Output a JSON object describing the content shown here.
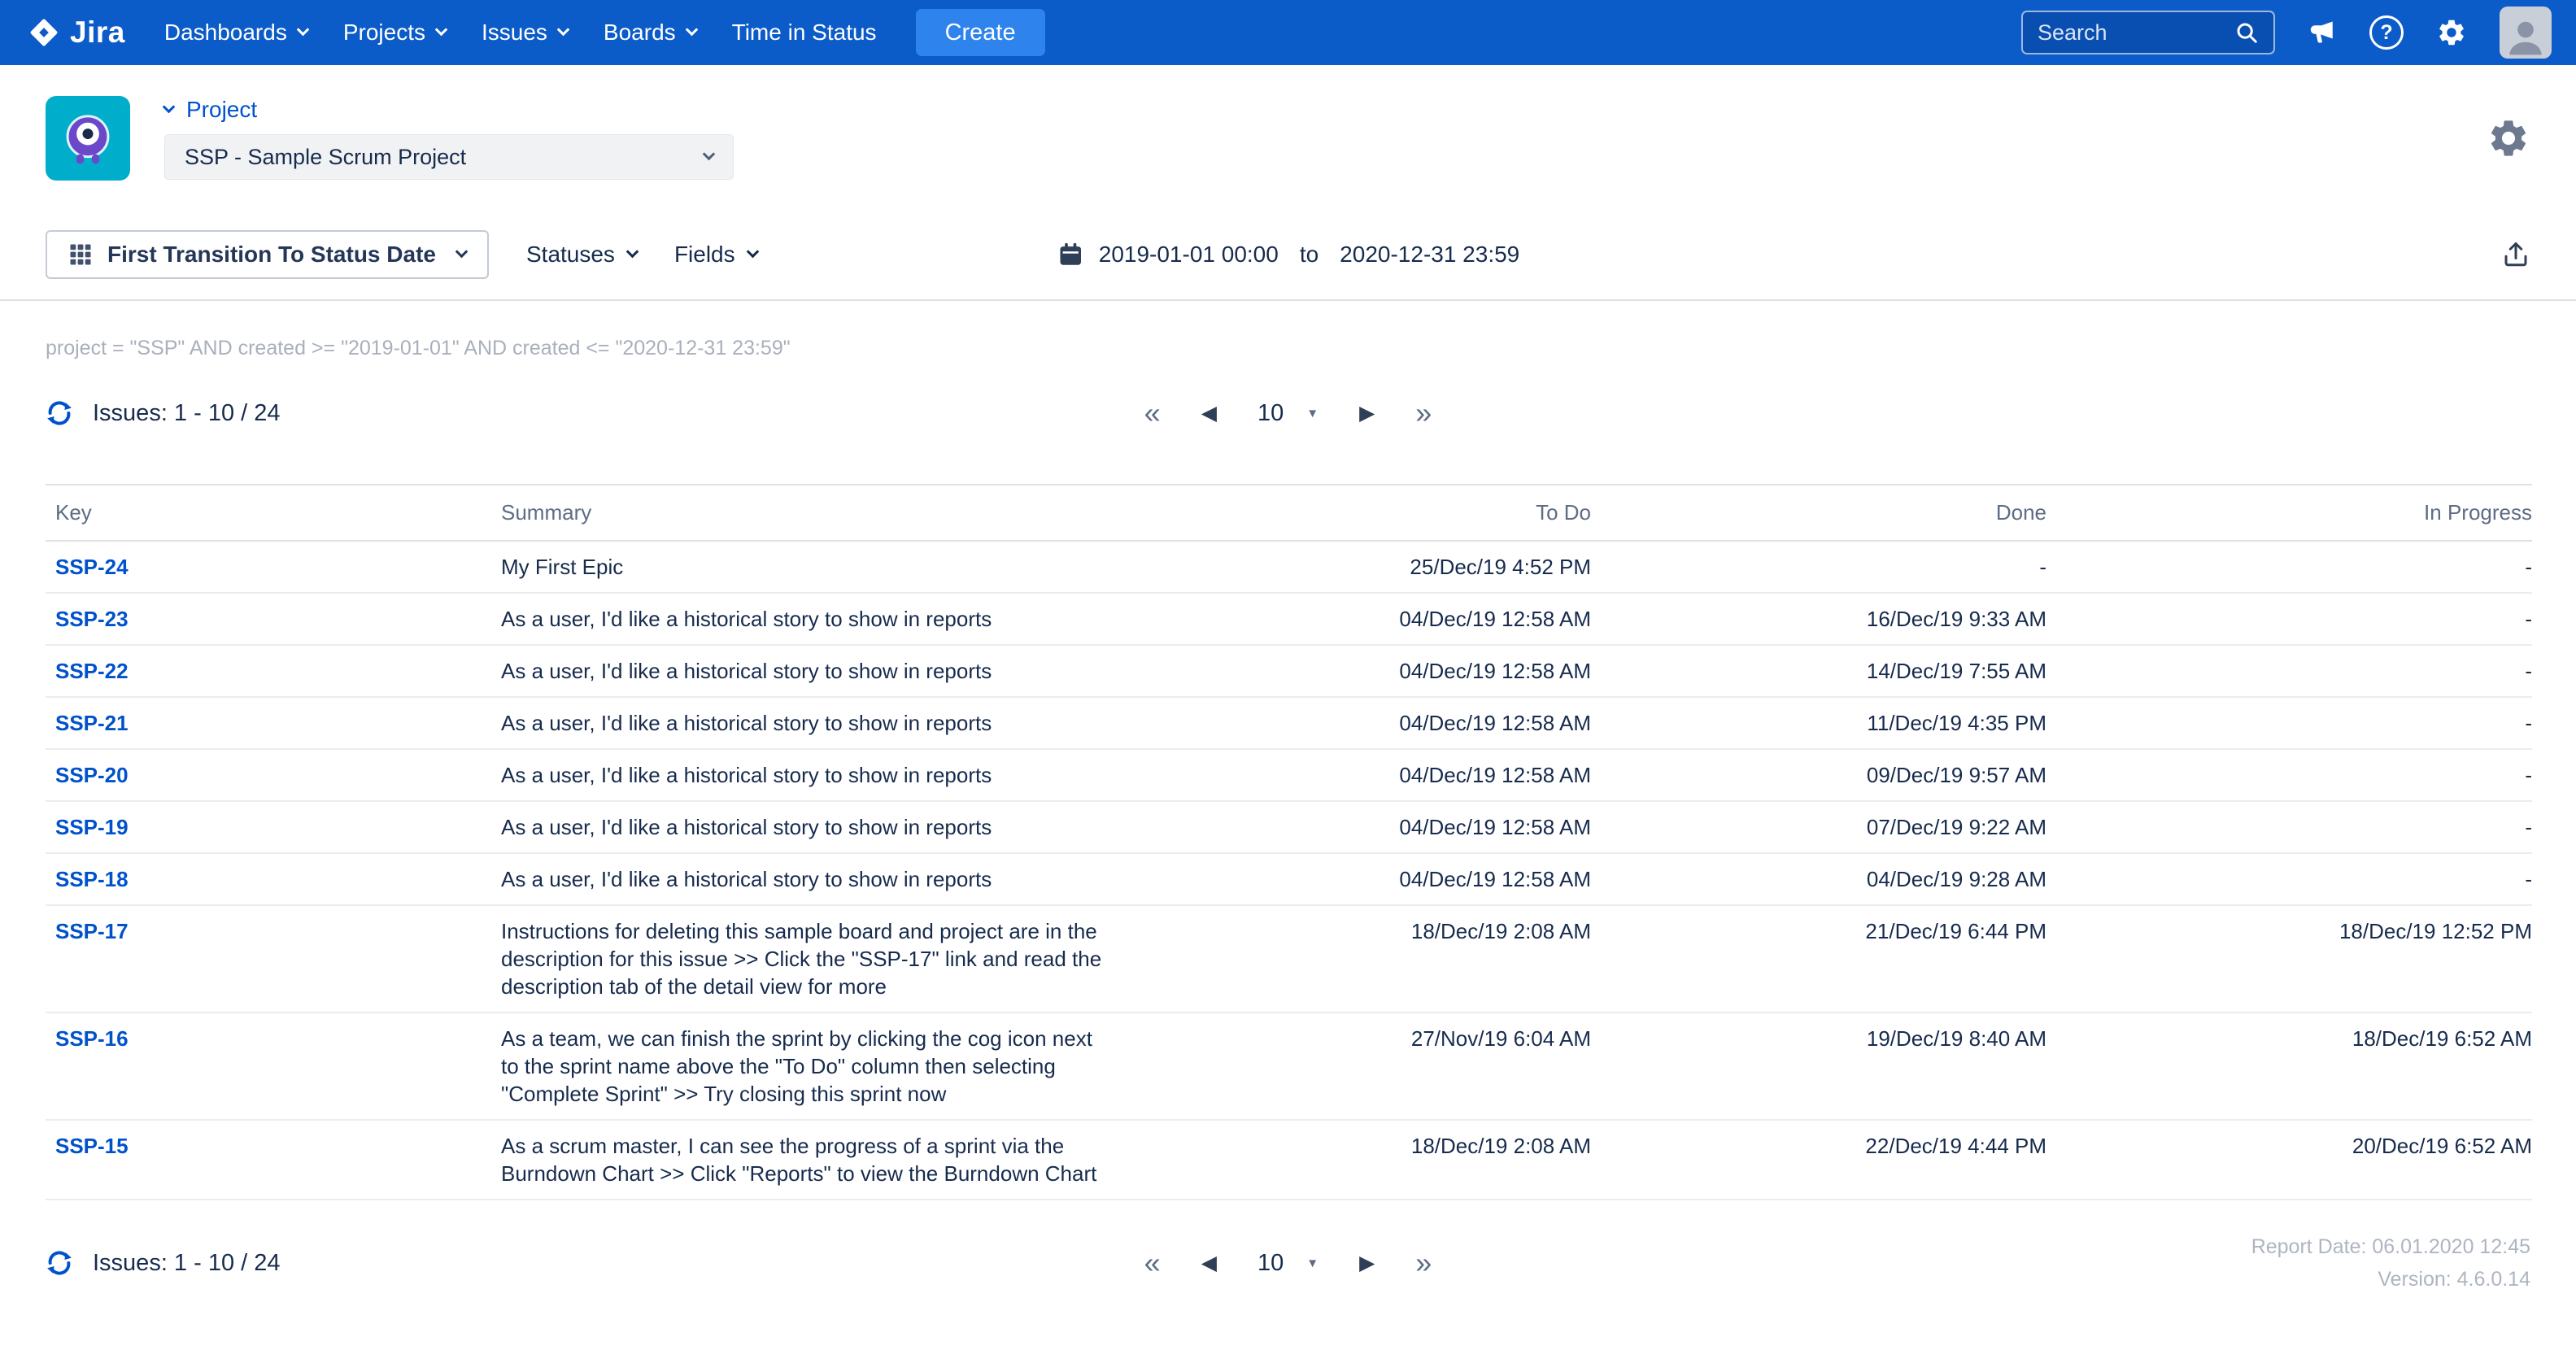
{
  "colors": {
    "navbar": "#0B5BC8",
    "create_button": "#2E83EC",
    "link": "#0052CC",
    "text": "#172B4D",
    "muted": "#5E6C84",
    "project_avatar_bg": "#00AECC"
  },
  "icons": {
    "first": "«",
    "prev": "◀",
    "next": "▶",
    "last": "»",
    "caret": "▼",
    "help": "?"
  },
  "nav": {
    "brand": "Jira",
    "items": [
      {
        "label": "Dashboards",
        "chevron": true
      },
      {
        "label": "Projects",
        "chevron": true
      },
      {
        "label": "Issues",
        "chevron": true
      },
      {
        "label": "Boards",
        "chevron": true
      },
      {
        "label": "Time in Status",
        "chevron": false
      }
    ],
    "create_label": "Create",
    "search_placeholder": "Search"
  },
  "header": {
    "project_label": "Project",
    "project_select": "SSP - Sample Scrum Project"
  },
  "filter_bar": {
    "report_type": "First Transition To Status Date",
    "statuses": "Statuses",
    "fields": "Fields",
    "date_from": "2019-01-01 00:00",
    "to_word": "to",
    "date_to": "2020-12-31 23:59"
  },
  "query": "project = \"SSP\" AND created >= \"2019-01-01\" AND created <= \"2020-12-31 23:59\"",
  "pagination": {
    "issues_label": "Issues: 1 - 10 / 24",
    "page_size": "10"
  },
  "table": {
    "columns": [
      "Key",
      "Summary",
      "To Do",
      "Done",
      "In Progress"
    ],
    "rows": [
      {
        "key": "SSP-24",
        "summary": "My First Epic",
        "todo": "25/Dec/19 4:52 PM",
        "done": "-",
        "in_progress": "-"
      },
      {
        "key": "SSP-23",
        "summary": "As a user, I'd like a historical story to show in reports",
        "todo": "04/Dec/19 12:58 AM",
        "done": "16/Dec/19 9:33 AM",
        "in_progress": "-"
      },
      {
        "key": "SSP-22",
        "summary": "As a user, I'd like a historical story to show in reports",
        "todo": "04/Dec/19 12:58 AM",
        "done": "14/Dec/19 7:55 AM",
        "in_progress": "-"
      },
      {
        "key": "SSP-21",
        "summary": "As a user, I'd like a historical story to show in reports",
        "todo": "04/Dec/19 12:58 AM",
        "done": "11/Dec/19 4:35 PM",
        "in_progress": "-"
      },
      {
        "key": "SSP-20",
        "summary": "As a user, I'd like a historical story to show in reports",
        "todo": "04/Dec/19 12:58 AM",
        "done": "09/Dec/19 9:57 AM",
        "in_progress": "-"
      },
      {
        "key": "SSP-19",
        "summary": "As a user, I'd like a historical story to show in reports",
        "todo": "04/Dec/19 12:58 AM",
        "done": "07/Dec/19 9:22 AM",
        "in_progress": "-"
      },
      {
        "key": "SSP-18",
        "summary": "As a user, I'd like a historical story to show in reports",
        "todo": "04/Dec/19 12:58 AM",
        "done": "04/Dec/19 9:28 AM",
        "in_progress": "-"
      },
      {
        "key": "SSP-17",
        "summary": "Instructions for deleting this sample board and project are in the description for this issue >> Click the \"SSP-17\" link and read the description tab of the detail view for more",
        "todo": "18/Dec/19 2:08 AM",
        "done": "21/Dec/19 6:44 PM",
        "in_progress": "18/Dec/19 12:52 PM"
      },
      {
        "key": "SSP-16",
        "summary": "As a team, we can finish the sprint by clicking the cog icon next to the sprint name above the \"To Do\" column then selecting \"Complete Sprint\" >> Try closing this sprint now",
        "todo": "27/Nov/19 6:04 AM",
        "done": "19/Dec/19 8:40 AM",
        "in_progress": "18/Dec/19 6:52 AM"
      },
      {
        "key": "SSP-15",
        "summary": "As a scrum master, I can see the progress of a sprint via the Burndown Chart >> Click \"Reports\" to view the Burndown Chart",
        "todo": "18/Dec/19 2:08 AM",
        "done": "22/Dec/19 4:44 PM",
        "in_progress": "20/Dec/19 6:52 AM"
      }
    ]
  },
  "footer": {
    "report_date": "Report Date: 06.01.2020 12:45",
    "version": "Version: 4.6.0.14"
  }
}
